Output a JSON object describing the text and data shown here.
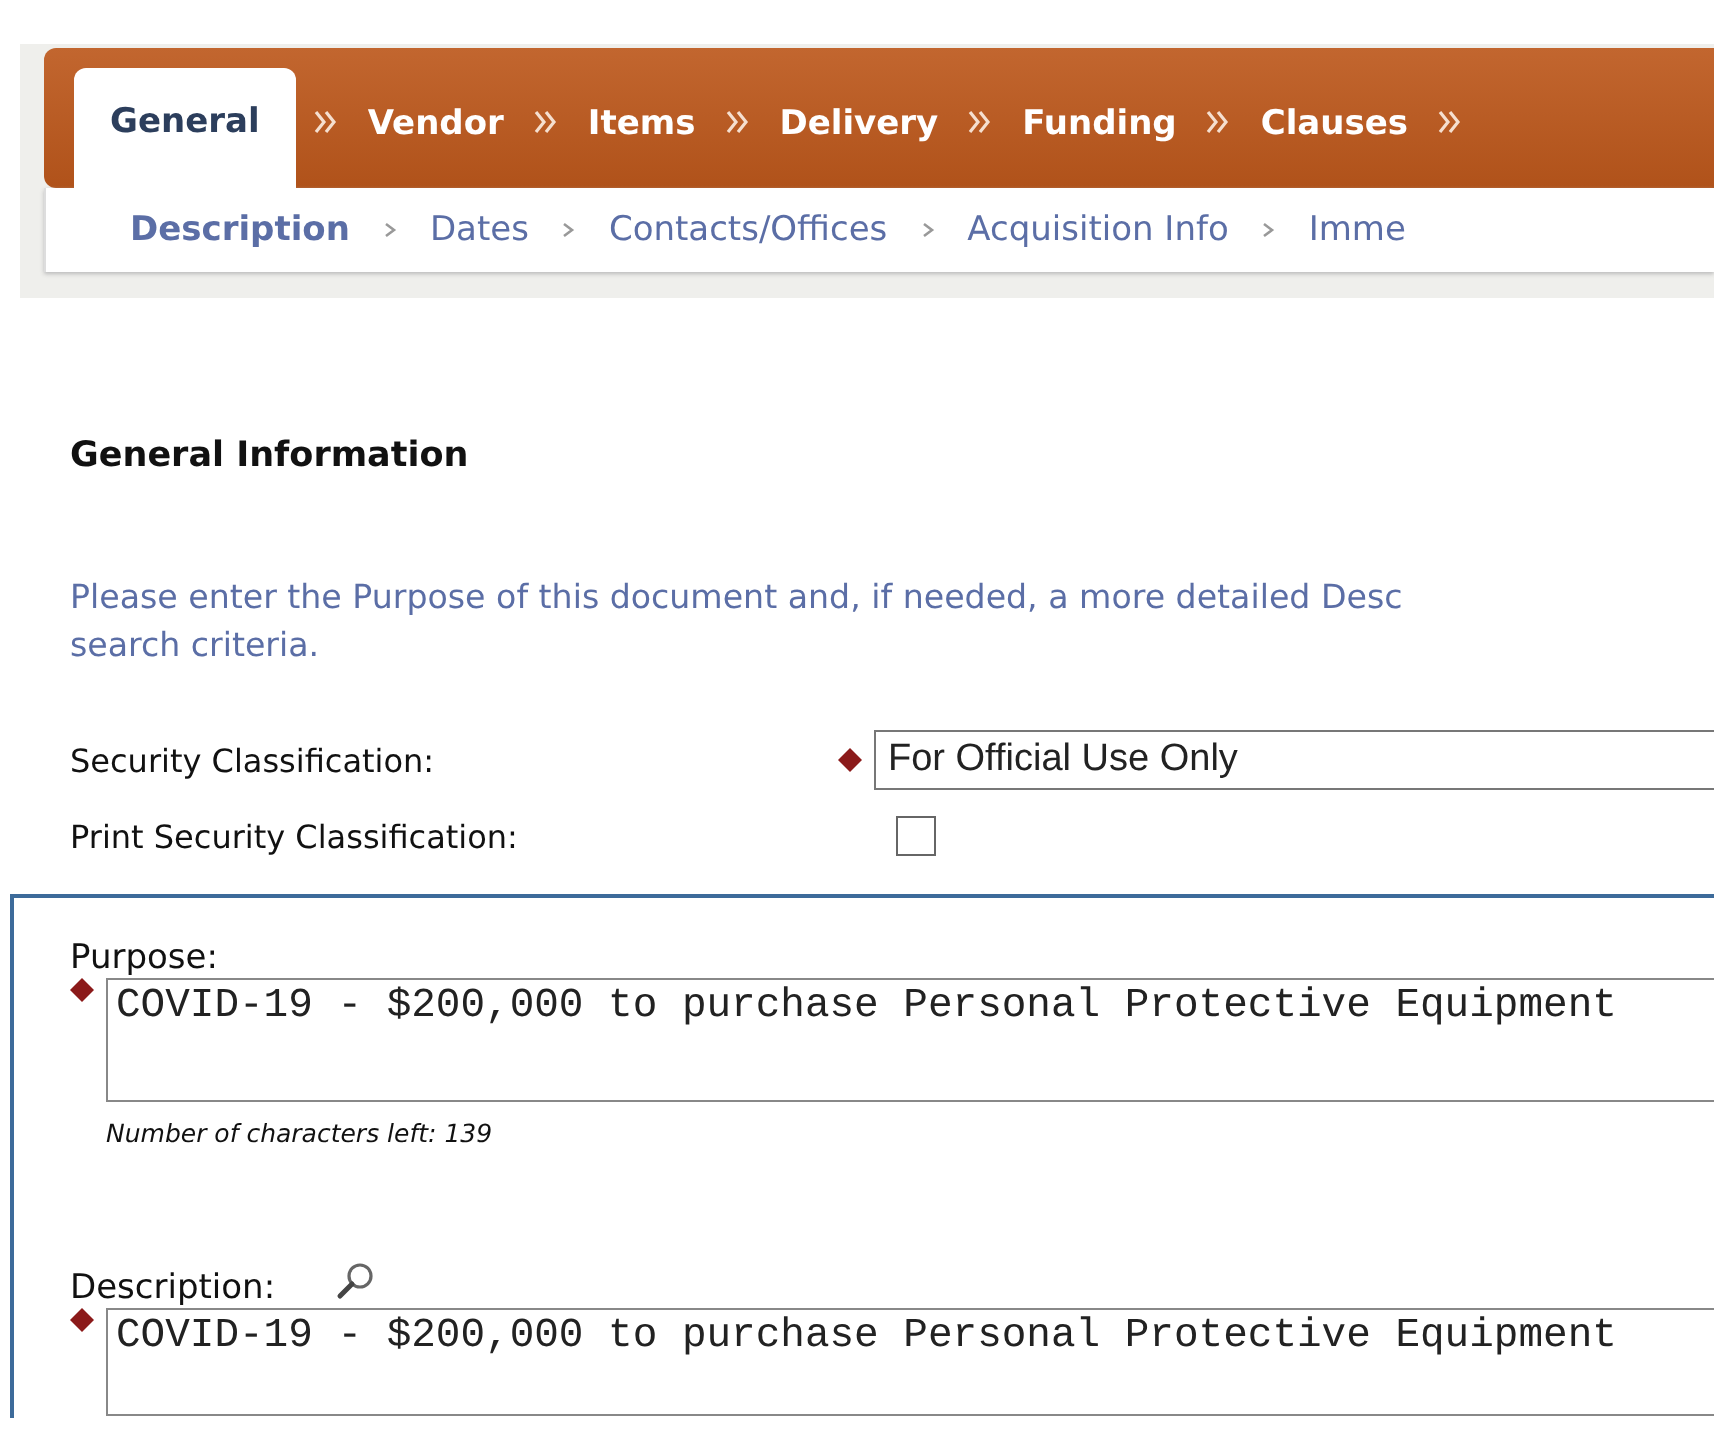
{
  "tabs": [
    {
      "label": "General",
      "selected": true
    },
    {
      "label": "Vendor",
      "selected": false
    },
    {
      "label": "Items",
      "selected": false
    },
    {
      "label": "Delivery",
      "selected": false
    },
    {
      "label": "Funding",
      "selected": false
    },
    {
      "label": "Clauses",
      "selected": false
    }
  ],
  "subtabs": [
    {
      "label": "Description",
      "selected": true
    },
    {
      "label": "Dates",
      "selected": false
    },
    {
      "label": "Contacts/Offices",
      "selected": false
    },
    {
      "label": "Acquisition Info",
      "selected": false
    },
    {
      "label": "Imme",
      "selected": false
    }
  ],
  "section_title": "General Information",
  "help_lines": [
    "Please enter the Purpose of this document and, if needed, a more detailed Desc",
    "search criteria."
  ],
  "fields": [
    {
      "kind": "select",
      "label": "Security Classification:",
      "required": true,
      "value": "For Official Use Only"
    },
    {
      "kind": "checkbox",
      "label": "Print Security Classification:",
      "required": false,
      "checked": false
    }
  ],
  "panel_fields": [
    {
      "label": "Purpose:",
      "required": true,
      "lookup": false,
      "value": "COVID-19 - $200,000 to purchase Personal Protective Equipment",
      "hint": "Number of characters left: 139"
    },
    {
      "label": "Description:",
      "required": true,
      "lookup": true,
      "value": "COVID-19 - $200,000 to purchase Personal Protective Equipment"
    }
  ]
}
